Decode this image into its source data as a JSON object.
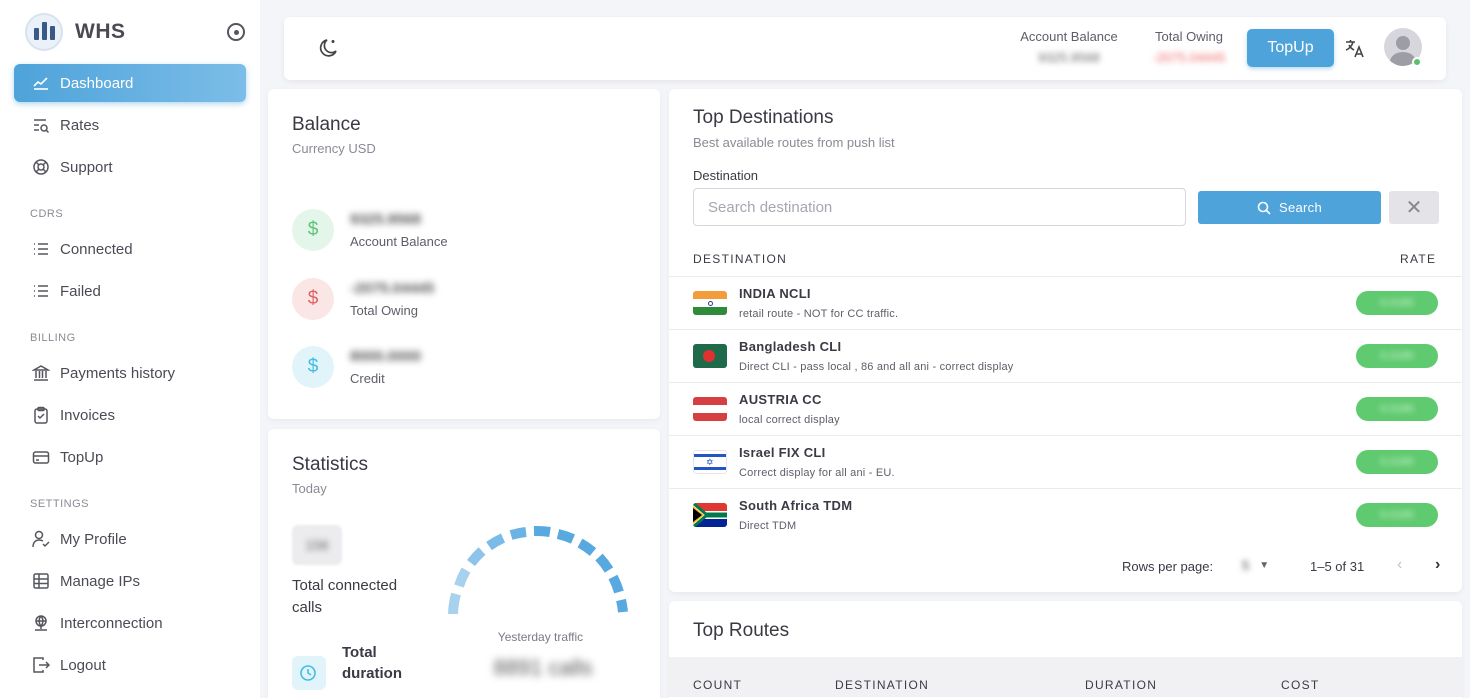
{
  "brand": {
    "name": "WHS"
  },
  "sidebar": {
    "items": [
      {
        "label": "Dashboard",
        "icon": "chart-line-icon",
        "active": true
      },
      {
        "label": "Rates",
        "icon": "list-search-icon"
      },
      {
        "label": "Support",
        "icon": "lifebuoy-icon"
      }
    ],
    "sections": [
      {
        "title": "CDRS",
        "items": [
          {
            "label": "Connected",
            "icon": "list-icon"
          },
          {
            "label": "Failed",
            "icon": "list-icon"
          }
        ]
      },
      {
        "title": "BILLING",
        "items": [
          {
            "label": "Payments history",
            "icon": "bank-icon"
          },
          {
            "label": "Invoices",
            "icon": "clipboard-icon"
          },
          {
            "label": "TopUp",
            "icon": "credit-card-icon"
          }
        ]
      },
      {
        "title": "SETTINGS",
        "items": [
          {
            "label": "My Profile",
            "icon": "user-check-icon"
          },
          {
            "label": "Manage IPs",
            "icon": "table-icon"
          },
          {
            "label": "Interconnection",
            "icon": "network-icon"
          },
          {
            "label": "Logout",
            "icon": "logout-icon"
          }
        ]
      }
    ]
  },
  "topbar": {
    "account_balance_label": "Account Balance",
    "account_balance_value": "9325.9568",
    "total_owing_label": "Total Owing",
    "total_owing_value": "-2075.04445",
    "topup_label": "TopUp"
  },
  "balance": {
    "title": "Balance",
    "subtitle": "Currency USD",
    "rows": [
      {
        "value": "9325.9568",
        "label": "Account Balance",
        "color": "#5fc27a",
        "bg": "#e4f6ea"
      },
      {
        "value": "-2075.04445",
        "label": "Total Owing",
        "color": "#e06363",
        "bg": "#fbe6e6"
      },
      {
        "value": "8000.0000",
        "label": "Credit",
        "color": "#43bde0",
        "bg": "#e1f4fa"
      }
    ]
  },
  "statistics": {
    "title": "Statistics",
    "subtitle": "Today",
    "connected_value": "156",
    "connected_label": "Total connected calls",
    "duration_label": "Total duration",
    "yesterday_label": "Yesterday traffic",
    "yesterday_value": "8891 calls"
  },
  "destinations": {
    "title": "Top Destinations",
    "subtitle": "Best available routes from push list",
    "field_label": "Destination",
    "placeholder": "Search destination",
    "search_label": "Search",
    "col_destination": "DESTINATION",
    "col_rate": "RATE",
    "rows": [
      {
        "name": "INDIA NCLI",
        "desc": "retail route - NOT for CC traffic.",
        "rate": "0.0180",
        "flag": "in"
      },
      {
        "name": "Bangladesh CLI",
        "desc": "Direct CLI - pass local , 86 and all ani - correct display",
        "rate": "0.0180",
        "flag": "bd"
      },
      {
        "name": "AUSTRIA CC",
        "desc": "local correct display",
        "rate": "0.0180",
        "flag": "at"
      },
      {
        "name": "Israel FIX CLI",
        "desc": "Correct display for all ani - EU.",
        "rate": "0.0180",
        "flag": "il"
      },
      {
        "name": "South Africa TDM",
        "desc": "Direct TDM",
        "rate": "0.0180",
        "flag": "za"
      }
    ],
    "rows_per_page_label": "Rows per page:",
    "rows_per_page_value": "5",
    "page_info": "1–5 of 31"
  },
  "routes": {
    "title": "Top Routes",
    "col_count": "COUNT",
    "col_destination": "DESTINATION",
    "col_duration": "DURATION",
    "col_cost": "COST"
  },
  "colors": {
    "accent": "#4ea3da",
    "rate_pill": "#5fca6f"
  }
}
